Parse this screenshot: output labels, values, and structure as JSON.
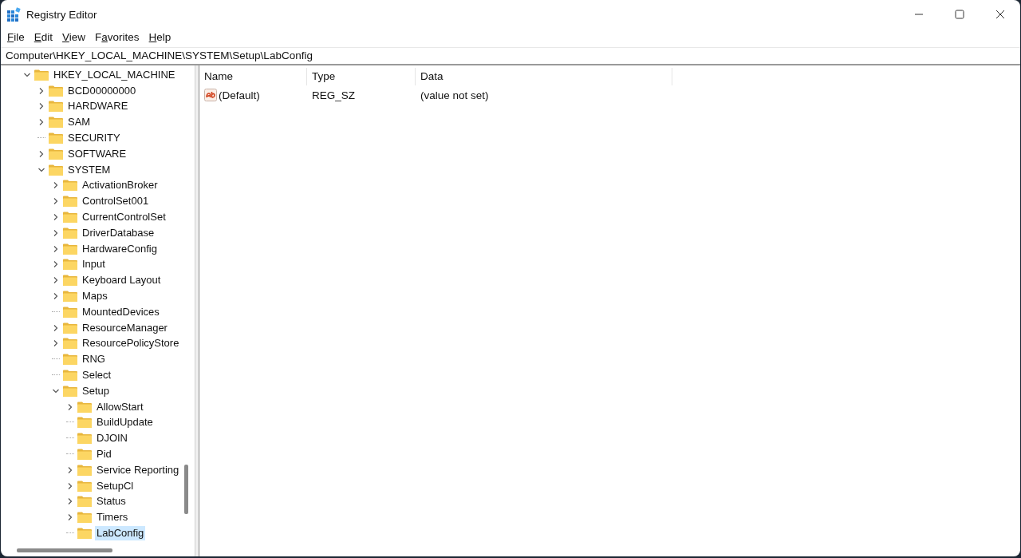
{
  "window": {
    "title": "Registry Editor"
  },
  "menu": [
    {
      "key": "F",
      "post": "ile"
    },
    {
      "key": "E",
      "post": "dit"
    },
    {
      "key": "V",
      "post": "iew"
    },
    {
      "pre": "F",
      "key": "a",
      "post": "vorites"
    },
    {
      "key": "H",
      "post": "elp"
    }
  ],
  "address_bar": {
    "value": "Computer\\HKEY_LOCAL_MACHINE\\SYSTEM\\Setup\\LabConfig"
  },
  "tree": [
    {
      "name": "HKEY_LOCAL_MACHINE",
      "expandable": true,
      "expanded": true,
      "selected": false,
      "children": [
        {
          "name": "BCD00000000",
          "expandable": true,
          "expanded": false,
          "selected": false
        },
        {
          "name": "HARDWARE",
          "expandable": true,
          "expanded": false,
          "selected": false
        },
        {
          "name": "SAM",
          "expandable": true,
          "expanded": false,
          "selected": false
        },
        {
          "name": "SECURITY",
          "expandable": false,
          "selected": false
        },
        {
          "name": "SOFTWARE",
          "expandable": true,
          "expanded": false,
          "selected": false
        },
        {
          "name": "SYSTEM",
          "expandable": true,
          "expanded": true,
          "selected": false,
          "children": [
            {
              "name": "ActivationBroker",
              "expandable": true,
              "expanded": false,
              "selected": false
            },
            {
              "name": "ControlSet001",
              "expandable": true,
              "expanded": false,
              "selected": false
            },
            {
              "name": "CurrentControlSet",
              "expandable": true,
              "expanded": false,
              "selected": false
            },
            {
              "name": "DriverDatabase",
              "expandable": true,
              "expanded": false,
              "selected": false
            },
            {
              "name": "HardwareConfig",
              "expandable": true,
              "expanded": false,
              "selected": false
            },
            {
              "name": "Input",
              "expandable": true,
              "expanded": false,
              "selected": false
            },
            {
              "name": "Keyboard Layout",
              "expandable": true,
              "expanded": false,
              "selected": false
            },
            {
              "name": "Maps",
              "expandable": true,
              "expanded": false,
              "selected": false
            },
            {
              "name": "MountedDevices",
              "expandable": false,
              "selected": false
            },
            {
              "name": "ResourceManager",
              "expandable": true,
              "expanded": false,
              "selected": false
            },
            {
              "name": "ResourcePolicyStore",
              "expandable": true,
              "expanded": false,
              "selected": false
            },
            {
              "name": "RNG",
              "expandable": false,
              "selected": false
            },
            {
              "name": "Select",
              "expandable": false,
              "selected": false
            },
            {
              "name": "Setup",
              "expandable": true,
              "expanded": true,
              "selected": false,
              "children": [
                {
                  "name": "AllowStart",
                  "expandable": true,
                  "expanded": false,
                  "selected": false
                },
                {
                  "name": "BuildUpdate",
                  "expandable": false,
                  "selected": false
                },
                {
                  "name": "DJOIN",
                  "expandable": false,
                  "selected": false
                },
                {
                  "name": "Pid",
                  "expandable": false,
                  "selected": false
                },
                {
                  "name": "Service Reporting",
                  "expandable": true,
                  "expanded": false,
                  "selected": false
                },
                {
                  "name": "SetupCl",
                  "expandable": true,
                  "expanded": false,
                  "selected": false
                },
                {
                  "name": "Status",
                  "expandable": true,
                  "expanded": false,
                  "selected": false
                },
                {
                  "name": "Timers",
                  "expandable": true,
                  "expanded": false,
                  "selected": false
                },
                {
                  "name": "LabConfig",
                  "expandable": false,
                  "selected": true
                }
              ]
            }
          ]
        }
      ]
    }
  ],
  "values": {
    "columns": [
      "Name",
      "Type",
      "Data"
    ],
    "rows": [
      {
        "kind": "string",
        "name": "(Default)",
        "type": "REG_SZ",
        "data": "(value not set)"
      }
    ]
  }
}
